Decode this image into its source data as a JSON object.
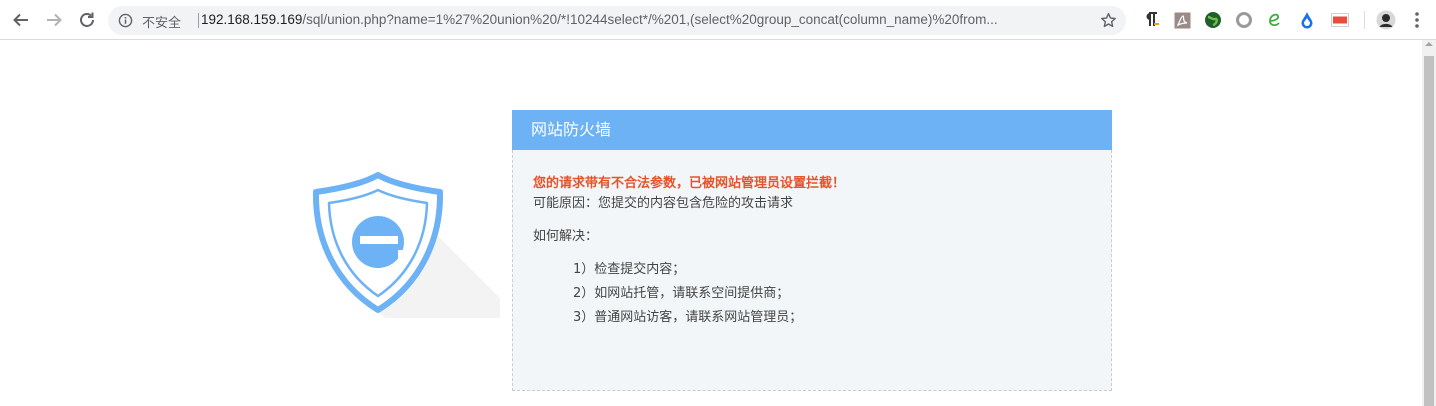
{
  "browser": {
    "security_label": "不安全",
    "url_host": "192.168.159.169",
    "url_path": "/sql/union.php?name=1%27%20union%20/*!10244select*/%201,(select%20group_concat(column_name)%20from...",
    "extensions": [
      "paragraph-icon",
      "pdf-icon",
      "green-globe-icon",
      "circle-icon",
      "e-icon",
      "water-drop-icon",
      "pdf-badge-icon",
      "avatar-icon"
    ]
  },
  "waf": {
    "title": "网站防火墙",
    "warning": "您的请求带有不合法参数，已被网站管理员设置拦截！",
    "reason": "可能原因：您提交的内容包含危险的攻击请求",
    "howto": "如何解决：",
    "steps": [
      "1）检查提交内容；",
      "2）如网站托管，请联系空间提供商；",
      "3）普通网站访客，请联系网站管理员；"
    ],
    "colors": {
      "header": "#6cb2f5",
      "warning": "#e6532b",
      "body_bg": "#f3f6f8"
    }
  }
}
